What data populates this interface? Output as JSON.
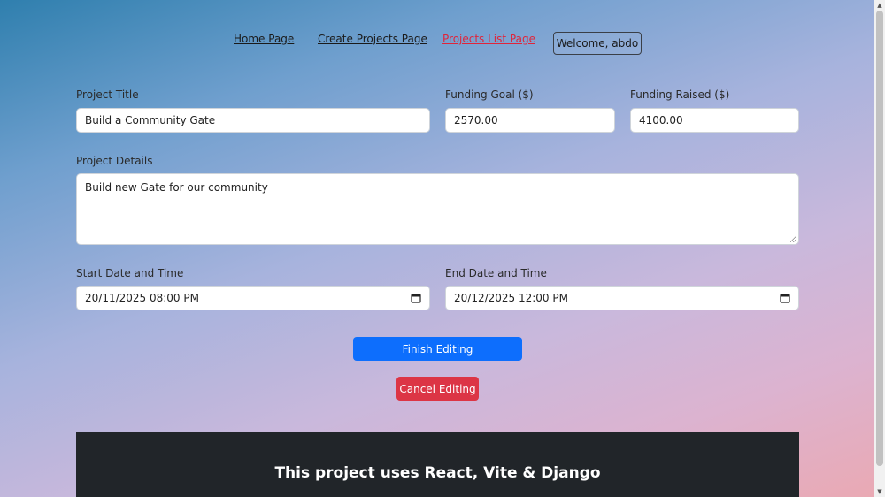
{
  "nav": {
    "home": "Home Page",
    "create": "Create Projects Page",
    "list": "Projects List Page",
    "welcome": "Welcome, abdo"
  },
  "form": {
    "title_label": "Project Title",
    "title_value": "Build a Community Gate",
    "goal_label": "Funding Goal ($)",
    "goal_value": "2570.00",
    "raised_label": "Funding Raised ($)",
    "raised_value": "4100.00",
    "details_label": "Project Details",
    "details_value": "Build new Gate for our community",
    "start_label": "Start Date and Time",
    "start_value": "20/11/2025 08:00  PM",
    "end_label": "End Date and Time",
    "end_value": "20/12/2025 12:00  PM"
  },
  "buttons": {
    "finish": "Finish Editing",
    "cancel": "Cancel Editing"
  },
  "footer": {
    "text": "This project uses React, Vite & Django"
  },
  "colors": {
    "primary": "#0d6efd",
    "danger": "#dc3545",
    "active_link": "#e0243a",
    "footer_bg": "#212529"
  },
  "icons": [
    "calendar-icon",
    "resize-grip-icon"
  ]
}
